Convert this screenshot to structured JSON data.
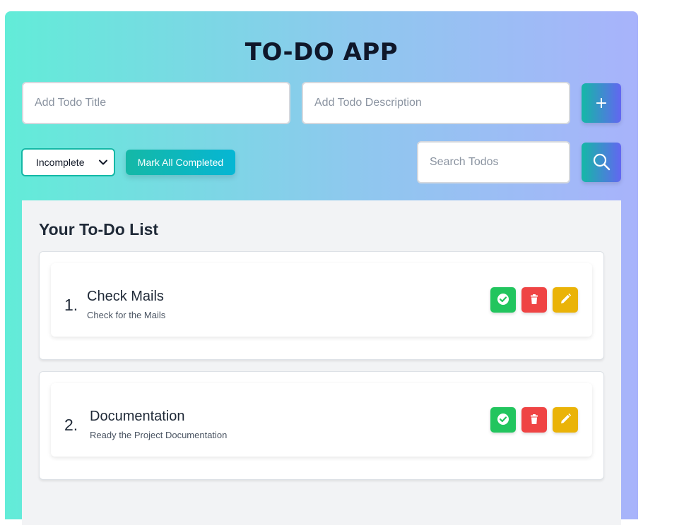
{
  "app": {
    "title": "TO-DO APP"
  },
  "form": {
    "title_placeholder": "Add Todo Title",
    "description_placeholder": "Add Todo Description",
    "add_label": "+"
  },
  "controls": {
    "filter_selected": "Incomplete",
    "mark_all_label": "Mark All Completed",
    "search_placeholder": "Search Todos"
  },
  "list": {
    "heading": "Your To-Do List",
    "items": [
      {
        "number": "1.",
        "title": "Check Mails",
        "description": "Check for the Mails"
      },
      {
        "number": "2.",
        "title": "Documentation",
        "description": "Ready the Project Documentation"
      }
    ]
  },
  "icons": {
    "add": "plus-icon",
    "search": "search-icon",
    "filter": "chevron-down-icon",
    "complete": "check-circle-icon",
    "delete": "trash-icon",
    "edit": "pencil-icon"
  },
  "colors": {
    "gradient_start": "#62ecd8",
    "gradient_end": "#a8b3fb",
    "complete": "#22c55e",
    "delete": "#ef4444",
    "edit": "#eab308",
    "accent": "#14b8a6"
  }
}
